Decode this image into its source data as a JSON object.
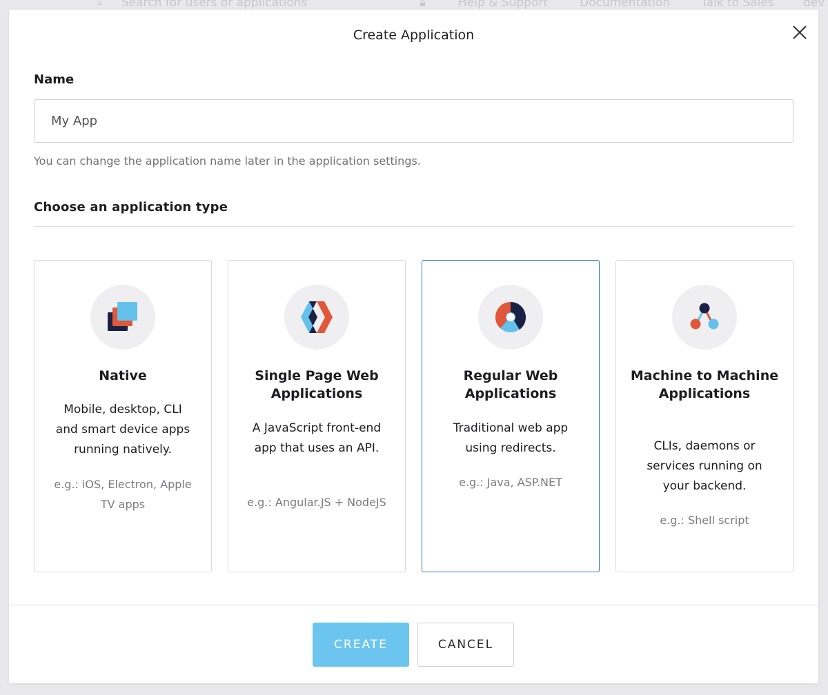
{
  "background": {
    "search_placeholder": "Search for users or applications",
    "nav": [
      "Help & Support",
      "Documentation",
      "Talk to Sales",
      "dev"
    ]
  },
  "modal": {
    "title": "Create Application",
    "name_label": "Name",
    "name_value": "My App",
    "name_help": "You can change the application name later in the application settings.",
    "type_heading": "Choose an application type",
    "cards": [
      {
        "title": "Native",
        "description": "Mobile, desktop, CLI and smart device apps running natively.",
        "example": "e.g.: iOS, Electron, Apple TV apps",
        "selected": false,
        "icon": "native-icon"
      },
      {
        "title": "Single Page Web Applications",
        "description": "A JavaScript front-end app that uses an API.",
        "example": "e.g.: Angular.JS + NodeJS",
        "selected": false,
        "icon": "spa-icon"
      },
      {
        "title": "Regular Web Applications",
        "description": "Traditional web app using redirects.",
        "example": "e.g.: Java, ASP.NET",
        "selected": true,
        "icon": "regular-web-icon"
      },
      {
        "title": "Machine to Machine Applications",
        "description": "CLIs, daemons or services running on your backend.",
        "example": "e.g.: Shell script",
        "selected": false,
        "icon": "m2m-icon"
      }
    ],
    "create_label": "CREATE",
    "cancel_label": "CANCEL"
  },
  "colors": {
    "accent_selected_border": "#2f7ab8",
    "create_button": "#6bc5ef",
    "orange": "#e0573a",
    "navy": "#1b2145",
    "light_blue": "#63c1ec"
  }
}
